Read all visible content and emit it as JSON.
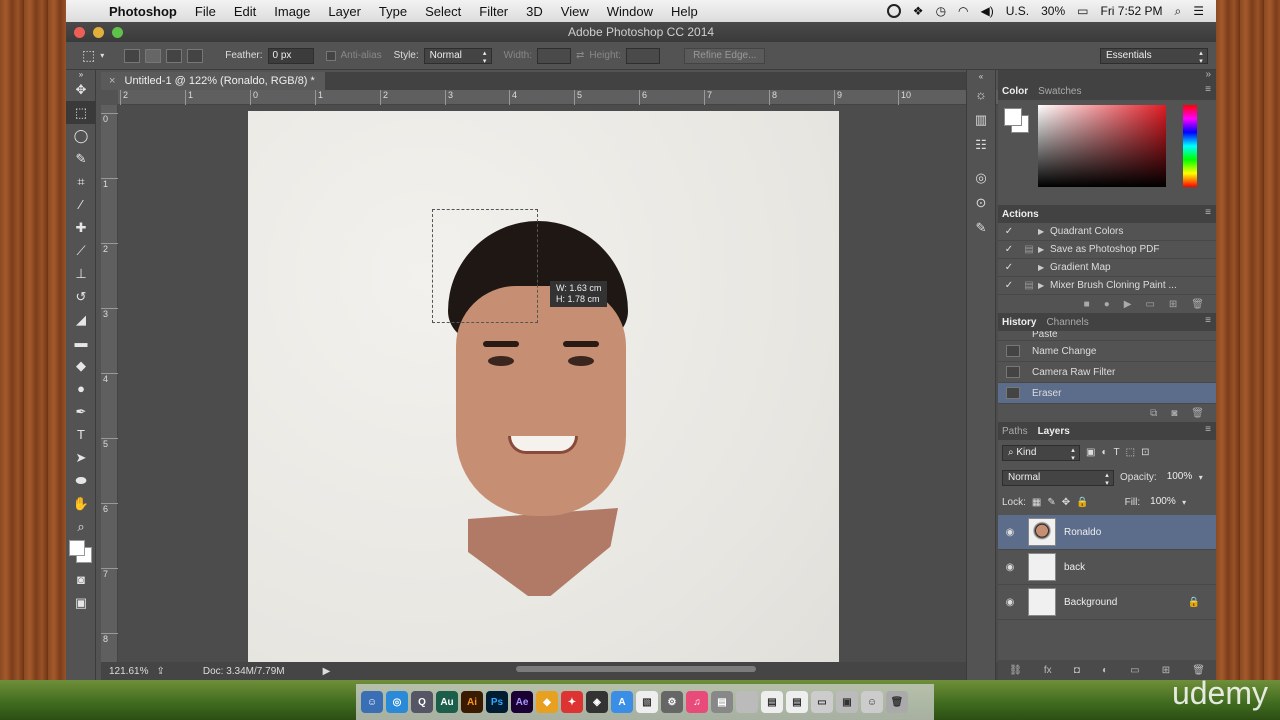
{
  "menubar": {
    "app_name": "Photoshop",
    "items": [
      "File",
      "Edit",
      "Image",
      "Layer",
      "Type",
      "Select",
      "Filter",
      "3D",
      "View",
      "Window",
      "Help"
    ],
    "input_source": "U.S.",
    "battery": "30%",
    "clock": "Fri 7:52 PM"
  },
  "window": {
    "title": "Adobe Photoshop CC 2014"
  },
  "options": {
    "feather_label": "Feather:",
    "feather_value": "0 px",
    "antialias_label": "Anti-alias",
    "style_label": "Style:",
    "style_value": "Normal",
    "width_label": "Width:",
    "height_label": "Height:",
    "refine_edge": "Refine Edge...",
    "workspace": "Essentials"
  },
  "document": {
    "tab_title": "Untitled-1 @ 122% (Ronaldo, RGB/8) *",
    "zoom": "121.61%",
    "doc_size": "Doc: 3.34M/7.79M",
    "ruler_h": [
      "2",
      "1",
      "0",
      "1",
      "2",
      "3",
      "4",
      "5",
      "6",
      "7",
      "8",
      "9",
      "10"
    ],
    "ruler_v": [
      "0",
      "1",
      "2",
      "3",
      "4",
      "5",
      "6",
      "7",
      "8"
    ],
    "selection_tip_w": "W: 1.63 cm",
    "selection_tip_h": "H: 1.78 cm"
  },
  "color_panel": {
    "tabs": [
      "Color",
      "Swatches"
    ],
    "accent": "#e01b24"
  },
  "actions_panel": {
    "title": "Actions",
    "items": [
      "Quadrant Colors",
      "Save as Photoshop PDF",
      "Gradient Map",
      "Mixer Brush Cloning Paint ..."
    ]
  },
  "history_panel": {
    "tabs": [
      "History",
      "Channels"
    ],
    "items": [
      "Paste",
      "Name Change",
      "Camera Raw Filter",
      "Eraser"
    ],
    "selected": "Eraser"
  },
  "layers_panel": {
    "tabs": [
      "Paths",
      "Layers"
    ],
    "kind_label": "Kind",
    "blend_mode": "Normal",
    "opacity_label": "Opacity:",
    "opacity_value": "100%",
    "lock_label": "Lock:",
    "fill_label": "Fill:",
    "fill_value": "100%",
    "layers": [
      "Ronaldo",
      "back",
      "Background"
    ],
    "selected_color": "#5b6d8b"
  },
  "dock": {
    "items": [
      "Ai",
      "Ps",
      "Ae",
      "Au"
    ]
  },
  "watermark": "udemy"
}
